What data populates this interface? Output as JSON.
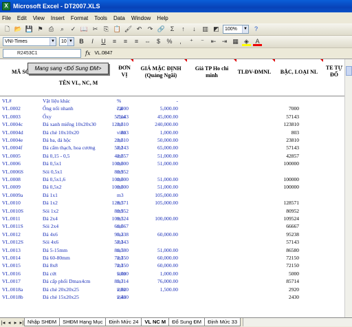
{
  "window": {
    "title": "Microsoft Excel - DT2007.XLS"
  },
  "menu": [
    "File",
    "Edit",
    "View",
    "Insert",
    "Format",
    "Tools",
    "Data",
    "Window",
    "Help"
  ],
  "toolbar": {
    "zoom": "100%",
    "font_name": "VNI-Times",
    "font_size": "10"
  },
  "formula": {
    "name_box": "R2453C1",
    "fx": "fx",
    "value": "VL.0847"
  },
  "macro_button": "Mang sang <Đổ Sung ĐM>",
  "headers": {
    "ma_so": "MÃ SỐ",
    "ten": "TÊN VL, NC, M",
    "don_vi": [
      "ĐƠN",
      "VỊ"
    ],
    "gia_mac_dinh": [
      "GIÁ MẶC ĐỊNH",
      "(Quảng Ngãi)"
    ],
    "gia_tp": [
      "Giá TP Ho chi",
      "minh"
    ],
    "tldv": "TLĐV-ĐMNL",
    "bac_loai": "BẬC, LOẠI NL",
    "te_tu_do": [
      "TE TỰ",
      "ĐỔ"
    ]
  },
  "rows": [
    [
      "VL#",
      "Vật liệu khác",
      "%",
      "",
      "-",
      "",
      ""
    ],
    [
      "VL.0002",
      "Ống nối nhanh",
      "cái",
      "7,000",
      "5,000.00",
      "",
      "7000"
    ],
    [
      "VL.0003",
      "Ốxy",
      "chai",
      "57,143",
      "45,000.00",
      "",
      "57143"
    ],
    [
      "VL.0004c",
      "Đá xanh miếng 10x20x30",
      "m3",
      "123,810",
      "240,000.00",
      "",
      "123810"
    ],
    [
      "VL.0004d",
      "Đá chẻ 10x10x20",
      "viên",
      "803",
      "1,000.00",
      "",
      "803"
    ],
    [
      "VL.0004e",
      "Đá ba, đá hộc",
      "m3",
      "23,810",
      "50,000.00",
      "",
      "23810"
    ],
    [
      "VL.0004f",
      "Đá cẩm thạch, hoa cương",
      "m2",
      "57,143",
      "65,000.00",
      "",
      "57143"
    ],
    [
      "VL.0005",
      "Đá 0,15 - 0,5",
      "m3",
      "42,857",
      "51,000.00",
      "",
      "42857"
    ],
    [
      "VL.0006",
      "Đá 0,5x1",
      "m3",
      "100,000",
      "51,000.00",
      "",
      "100000"
    ],
    [
      "VL.0006S",
      "Sỏi 0,5x1",
      "m3",
      "80,952",
      "",
      "",
      ""
    ],
    [
      "VL.0008",
      "Đá 0,5x1,6",
      "m3",
      "100,000",
      "51,000.00",
      "",
      "100000"
    ],
    [
      "VL.0009",
      "Đá 0,5x2",
      "m3",
      "100,000",
      "51,000.00",
      "",
      "100000"
    ],
    [
      "VL.0009a",
      "Đá 1x1",
      "m3",
      "",
      "105,000.00",
      "",
      ""
    ],
    [
      "VL.0010",
      "Đá 1x2",
      "m3",
      "128,571",
      "105,000.00",
      "",
      "128571"
    ],
    [
      "VL.0010S",
      "Sỏi 1x2",
      "m3",
      "80,952",
      "",
      "",
      "80952"
    ],
    [
      "VL.0011",
      "Đá 2x4",
      "m3",
      "109,524",
      "100,000.00",
      "",
      "109524"
    ],
    [
      "VL.0011S",
      "Sỏi 2x4",
      "m3",
      "66,667",
      "",
      "",
      "66667"
    ],
    [
      "VL.0012",
      "Đá 4x6",
      "m3",
      "95,238",
      "60,000.00",
      "",
      "95238"
    ],
    [
      "VL.0012S",
      "Sỏi 4x6",
      "m3",
      "57,143",
      "",
      "",
      "57143"
    ],
    [
      "VL.0013",
      "Đá 5-15mm",
      "m3",
      "86,580",
      "51,000.00",
      "",
      "86580"
    ],
    [
      "VL.0014",
      "Đá 60-80mm",
      "m3",
      "72,150",
      "60,000.00",
      "",
      "72150"
    ],
    [
      "VL.0015",
      "Đá 8x8",
      "m3",
      "72,150",
      "60,000.00",
      "",
      "72150"
    ],
    [
      "VL.0016",
      "Đá cứt",
      "viên",
      "5,000",
      "1,000.00",
      "",
      "5000"
    ],
    [
      "VL.0017",
      "Đá cấp phối Dmax4cm",
      "m3",
      "85,714",
      "76,000.00",
      "",
      "85714"
    ],
    [
      "VL.0018a",
      "Đá chẻ 20x20x25",
      "viên",
      "2,920",
      "1,500.00",
      "",
      "2920"
    ],
    [
      "VL.0018b",
      "Đá chẻ 15x20x25",
      "viên",
      "2,430",
      "",
      "",
      "2430"
    ]
  ],
  "tabs": [
    "Nhập SHĐM",
    "SHĐM Hạng Mục",
    "Định Mức 24",
    "VL NC M",
    "Đổ Sung ĐM",
    "Định Mức 33"
  ],
  "active_tab": "VL NC M"
}
